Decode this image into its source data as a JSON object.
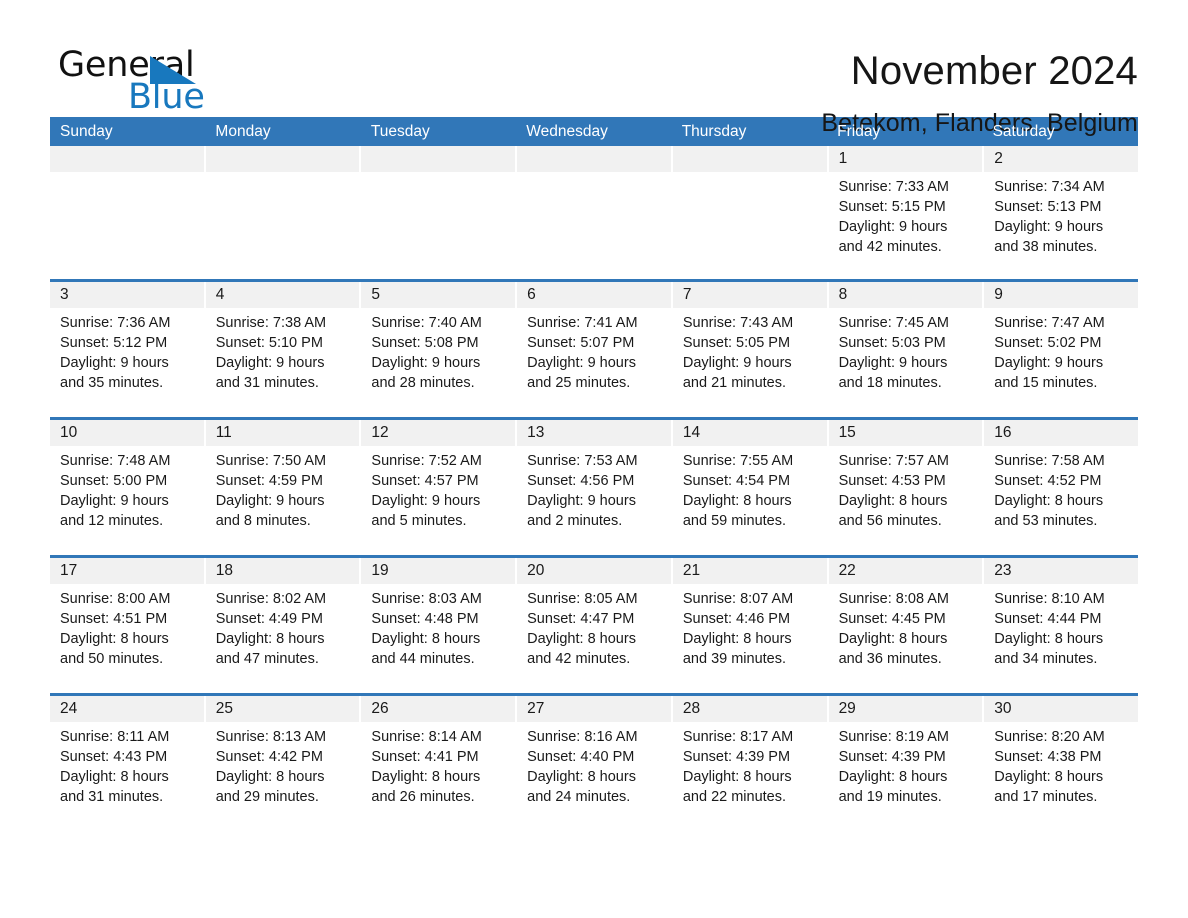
{
  "brand": {
    "word_one": "General",
    "word_two": "Blue",
    "accent_color": "#1878be"
  },
  "header": {
    "title": "November 2024",
    "location": "Betekom, Flanders, Belgium"
  },
  "theme": {
    "header_blue": "#3177b8",
    "daynum_band": "#f1f1f1",
    "text": "#1a1a1a"
  },
  "weekdays": [
    "Sunday",
    "Monday",
    "Tuesday",
    "Wednesday",
    "Thursday",
    "Friday",
    "Saturday"
  ],
  "weeks": [
    [
      {
        "day": "",
        "sunrise": "",
        "sunset": "",
        "daylight_1": "",
        "daylight_2": ""
      },
      {
        "day": "",
        "sunrise": "",
        "sunset": "",
        "daylight_1": "",
        "daylight_2": ""
      },
      {
        "day": "",
        "sunrise": "",
        "sunset": "",
        "daylight_1": "",
        "daylight_2": ""
      },
      {
        "day": "",
        "sunrise": "",
        "sunset": "",
        "daylight_1": "",
        "daylight_2": ""
      },
      {
        "day": "",
        "sunrise": "",
        "sunset": "",
        "daylight_1": "",
        "daylight_2": ""
      },
      {
        "day": "1",
        "sunrise": "Sunrise: 7:33 AM",
        "sunset": "Sunset: 5:15 PM",
        "daylight_1": "Daylight: 9 hours",
        "daylight_2": "and 42 minutes."
      },
      {
        "day": "2",
        "sunrise": "Sunrise: 7:34 AM",
        "sunset": "Sunset: 5:13 PM",
        "daylight_1": "Daylight: 9 hours",
        "daylight_2": "and 38 minutes."
      }
    ],
    [
      {
        "day": "3",
        "sunrise": "Sunrise: 7:36 AM",
        "sunset": "Sunset: 5:12 PM",
        "daylight_1": "Daylight: 9 hours",
        "daylight_2": "and 35 minutes."
      },
      {
        "day": "4",
        "sunrise": "Sunrise: 7:38 AM",
        "sunset": "Sunset: 5:10 PM",
        "daylight_1": "Daylight: 9 hours",
        "daylight_2": "and 31 minutes."
      },
      {
        "day": "5",
        "sunrise": "Sunrise: 7:40 AM",
        "sunset": "Sunset: 5:08 PM",
        "daylight_1": "Daylight: 9 hours",
        "daylight_2": "and 28 minutes."
      },
      {
        "day": "6",
        "sunrise": "Sunrise: 7:41 AM",
        "sunset": "Sunset: 5:07 PM",
        "daylight_1": "Daylight: 9 hours",
        "daylight_2": "and 25 minutes."
      },
      {
        "day": "7",
        "sunrise": "Sunrise: 7:43 AM",
        "sunset": "Sunset: 5:05 PM",
        "daylight_1": "Daylight: 9 hours",
        "daylight_2": "and 21 minutes."
      },
      {
        "day": "8",
        "sunrise": "Sunrise: 7:45 AM",
        "sunset": "Sunset: 5:03 PM",
        "daylight_1": "Daylight: 9 hours",
        "daylight_2": "and 18 minutes."
      },
      {
        "day": "9",
        "sunrise": "Sunrise: 7:47 AM",
        "sunset": "Sunset: 5:02 PM",
        "daylight_1": "Daylight: 9 hours",
        "daylight_2": "and 15 minutes."
      }
    ],
    [
      {
        "day": "10",
        "sunrise": "Sunrise: 7:48 AM",
        "sunset": "Sunset: 5:00 PM",
        "daylight_1": "Daylight: 9 hours",
        "daylight_2": "and 12 minutes."
      },
      {
        "day": "11",
        "sunrise": "Sunrise: 7:50 AM",
        "sunset": "Sunset: 4:59 PM",
        "daylight_1": "Daylight: 9 hours",
        "daylight_2": "and 8 minutes."
      },
      {
        "day": "12",
        "sunrise": "Sunrise: 7:52 AM",
        "sunset": "Sunset: 4:57 PM",
        "daylight_1": "Daylight: 9 hours",
        "daylight_2": "and 5 minutes."
      },
      {
        "day": "13",
        "sunrise": "Sunrise: 7:53 AM",
        "sunset": "Sunset: 4:56 PM",
        "daylight_1": "Daylight: 9 hours",
        "daylight_2": "and 2 minutes."
      },
      {
        "day": "14",
        "sunrise": "Sunrise: 7:55 AM",
        "sunset": "Sunset: 4:54 PM",
        "daylight_1": "Daylight: 8 hours",
        "daylight_2": "and 59 minutes."
      },
      {
        "day": "15",
        "sunrise": "Sunrise: 7:57 AM",
        "sunset": "Sunset: 4:53 PM",
        "daylight_1": "Daylight: 8 hours",
        "daylight_2": "and 56 minutes."
      },
      {
        "day": "16",
        "sunrise": "Sunrise: 7:58 AM",
        "sunset": "Sunset: 4:52 PM",
        "daylight_1": "Daylight: 8 hours",
        "daylight_2": "and 53 minutes."
      }
    ],
    [
      {
        "day": "17",
        "sunrise": "Sunrise: 8:00 AM",
        "sunset": "Sunset: 4:51 PM",
        "daylight_1": "Daylight: 8 hours",
        "daylight_2": "and 50 minutes."
      },
      {
        "day": "18",
        "sunrise": "Sunrise: 8:02 AM",
        "sunset": "Sunset: 4:49 PM",
        "daylight_1": "Daylight: 8 hours",
        "daylight_2": "and 47 minutes."
      },
      {
        "day": "19",
        "sunrise": "Sunrise: 8:03 AM",
        "sunset": "Sunset: 4:48 PM",
        "daylight_1": "Daylight: 8 hours",
        "daylight_2": "and 44 minutes."
      },
      {
        "day": "20",
        "sunrise": "Sunrise: 8:05 AM",
        "sunset": "Sunset: 4:47 PM",
        "daylight_1": "Daylight: 8 hours",
        "daylight_2": "and 42 minutes."
      },
      {
        "day": "21",
        "sunrise": "Sunrise: 8:07 AM",
        "sunset": "Sunset: 4:46 PM",
        "daylight_1": "Daylight: 8 hours",
        "daylight_2": "and 39 minutes."
      },
      {
        "day": "22",
        "sunrise": "Sunrise: 8:08 AM",
        "sunset": "Sunset: 4:45 PM",
        "daylight_1": "Daylight: 8 hours",
        "daylight_2": "and 36 minutes."
      },
      {
        "day": "23",
        "sunrise": "Sunrise: 8:10 AM",
        "sunset": "Sunset: 4:44 PM",
        "daylight_1": "Daylight: 8 hours",
        "daylight_2": "and 34 minutes."
      }
    ],
    [
      {
        "day": "24",
        "sunrise": "Sunrise: 8:11 AM",
        "sunset": "Sunset: 4:43 PM",
        "daylight_1": "Daylight: 8 hours",
        "daylight_2": "and 31 minutes."
      },
      {
        "day": "25",
        "sunrise": "Sunrise: 8:13 AM",
        "sunset": "Sunset: 4:42 PM",
        "daylight_1": "Daylight: 8 hours",
        "daylight_2": "and 29 minutes."
      },
      {
        "day": "26",
        "sunrise": "Sunrise: 8:14 AM",
        "sunset": "Sunset: 4:41 PM",
        "daylight_1": "Daylight: 8 hours",
        "daylight_2": "and 26 minutes."
      },
      {
        "day": "27",
        "sunrise": "Sunrise: 8:16 AM",
        "sunset": "Sunset: 4:40 PM",
        "daylight_1": "Daylight: 8 hours",
        "daylight_2": "and 24 minutes."
      },
      {
        "day": "28",
        "sunrise": "Sunrise: 8:17 AM",
        "sunset": "Sunset: 4:39 PM",
        "daylight_1": "Daylight: 8 hours",
        "daylight_2": "and 22 minutes."
      },
      {
        "day": "29",
        "sunrise": "Sunrise: 8:19 AM",
        "sunset": "Sunset: 4:39 PM",
        "daylight_1": "Daylight: 8 hours",
        "daylight_2": "and 19 minutes."
      },
      {
        "day": "30",
        "sunrise": "Sunrise: 8:20 AM",
        "sunset": "Sunset: 4:38 PM",
        "daylight_1": "Daylight: 8 hours",
        "daylight_2": "and 17 minutes."
      }
    ]
  ]
}
